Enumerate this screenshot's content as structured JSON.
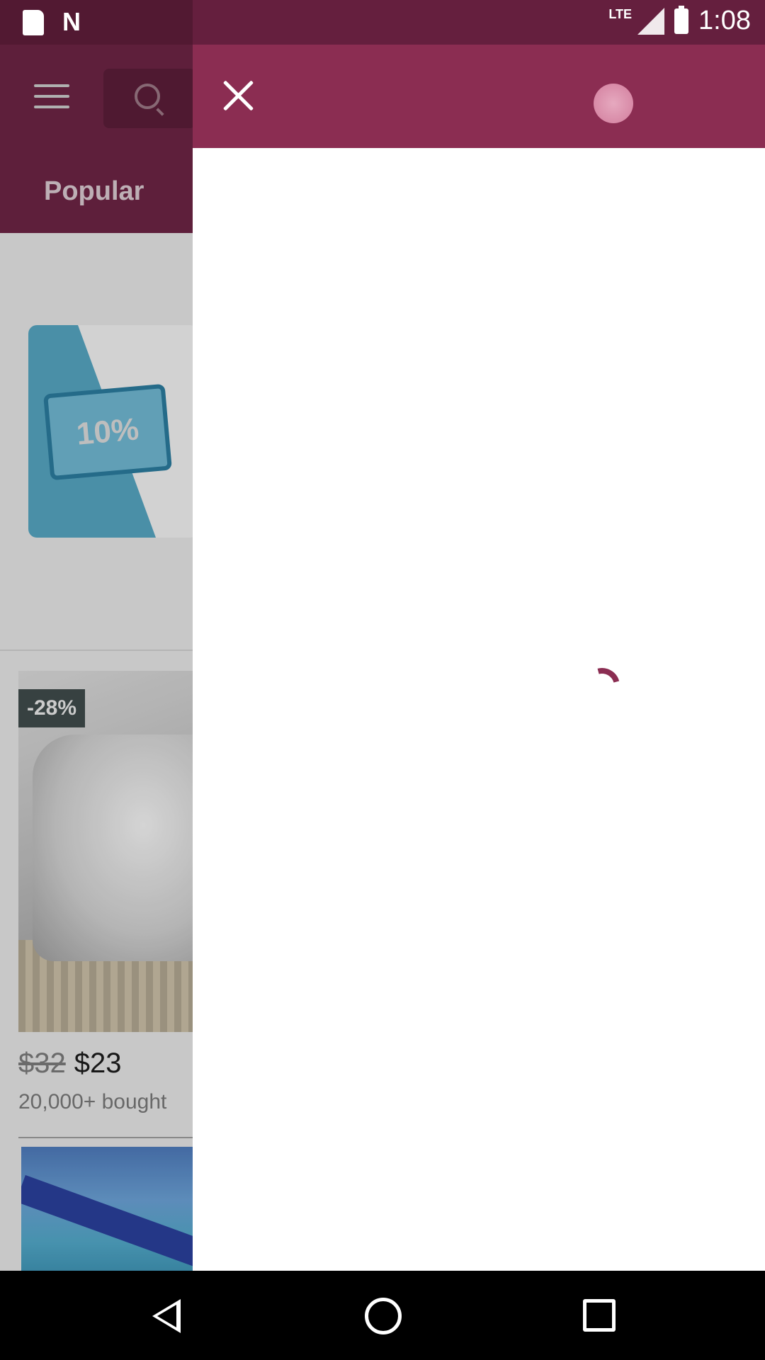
{
  "status_bar": {
    "network": "LTE",
    "time": "1:08"
  },
  "background_app": {
    "tab_label": "Popular",
    "coupon_text": "10%",
    "product": {
      "discount_badge": "-28%",
      "old_price": "$32",
      "new_price": "$23",
      "bought_text": "20,000+ bought"
    }
  },
  "colors": {
    "status_bar": "#651f3e",
    "panel_header": "#8b2d52",
    "spinner": "#8b2d52"
  }
}
